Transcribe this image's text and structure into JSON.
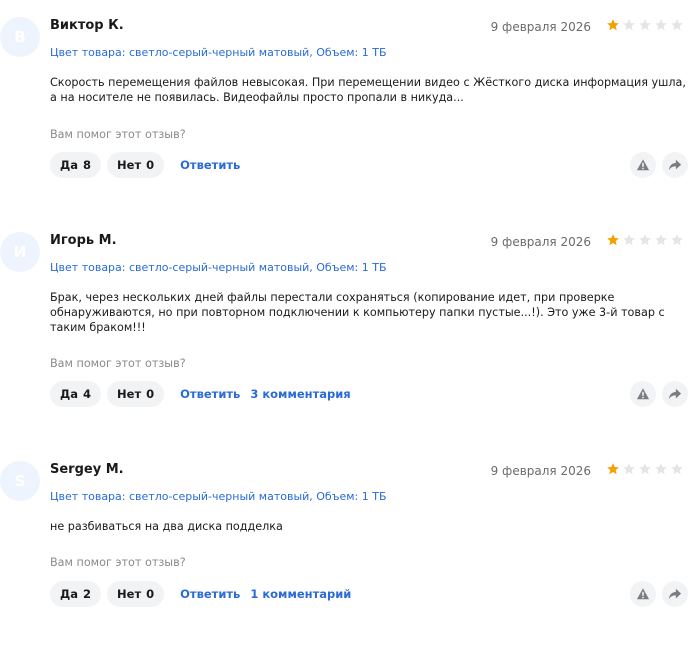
{
  "colors": {
    "accent": "#2a6bd6",
    "star_filled": "#f5a000",
    "star_empty": "#e3e5e8",
    "pill_bg": "#f2f3f5",
    "avatar_bg": "#eef4fd"
  },
  "helpful_question": "Вам помог этот отзыв?",
  "yes_label": "Да",
  "no_label": "Нет",
  "reply_label": "Ответить",
  "icons": {
    "report": "warning-icon",
    "share": "share-arrow-icon"
  },
  "reviews": [
    {
      "avatar_letter": "В",
      "author": "Виктор К.",
      "date": "9 февраля 2026",
      "rating": 1,
      "max_rating": 5,
      "variant": "Цвет товара: светло-серый-черный матовый, Объем: 1 ТБ",
      "text": "Скорость перемещения файлов невысокая. При перемещении видео с Жёсткого диска информация ушла, а на носителе не появилась. Видеофайлы просто пропали в никуда...",
      "yes_count": "8",
      "no_count": "0",
      "comments_label": ""
    },
    {
      "avatar_letter": "И",
      "author": "Игорь М.",
      "date": "9 февраля 2026",
      "rating": 1,
      "max_rating": 5,
      "variant": "Цвет товара: светло-серый-черный матовый, Объем: 1 ТБ",
      "text": "Брак, через нескольких дней файлы перестали сохраняться (копирование идет, при проверке обнаруживаются, но при повторном подключении к компьютеру папки пустые...!). Это уже 3-й товар с таким браком!!!",
      "yes_count": "4",
      "no_count": "0",
      "comments_label": "3 комментария"
    },
    {
      "avatar_letter": "S",
      "author": "Sergey M.",
      "date": "9 февраля 2026",
      "rating": 1,
      "max_rating": 5,
      "variant": "Цвет товара: светло-серый-черный матовый, Объем: 1 ТБ",
      "text": "не разбиваться на два диска подделка",
      "yes_count": "2",
      "no_count": "0",
      "comments_label": "1 комментарий"
    }
  ]
}
